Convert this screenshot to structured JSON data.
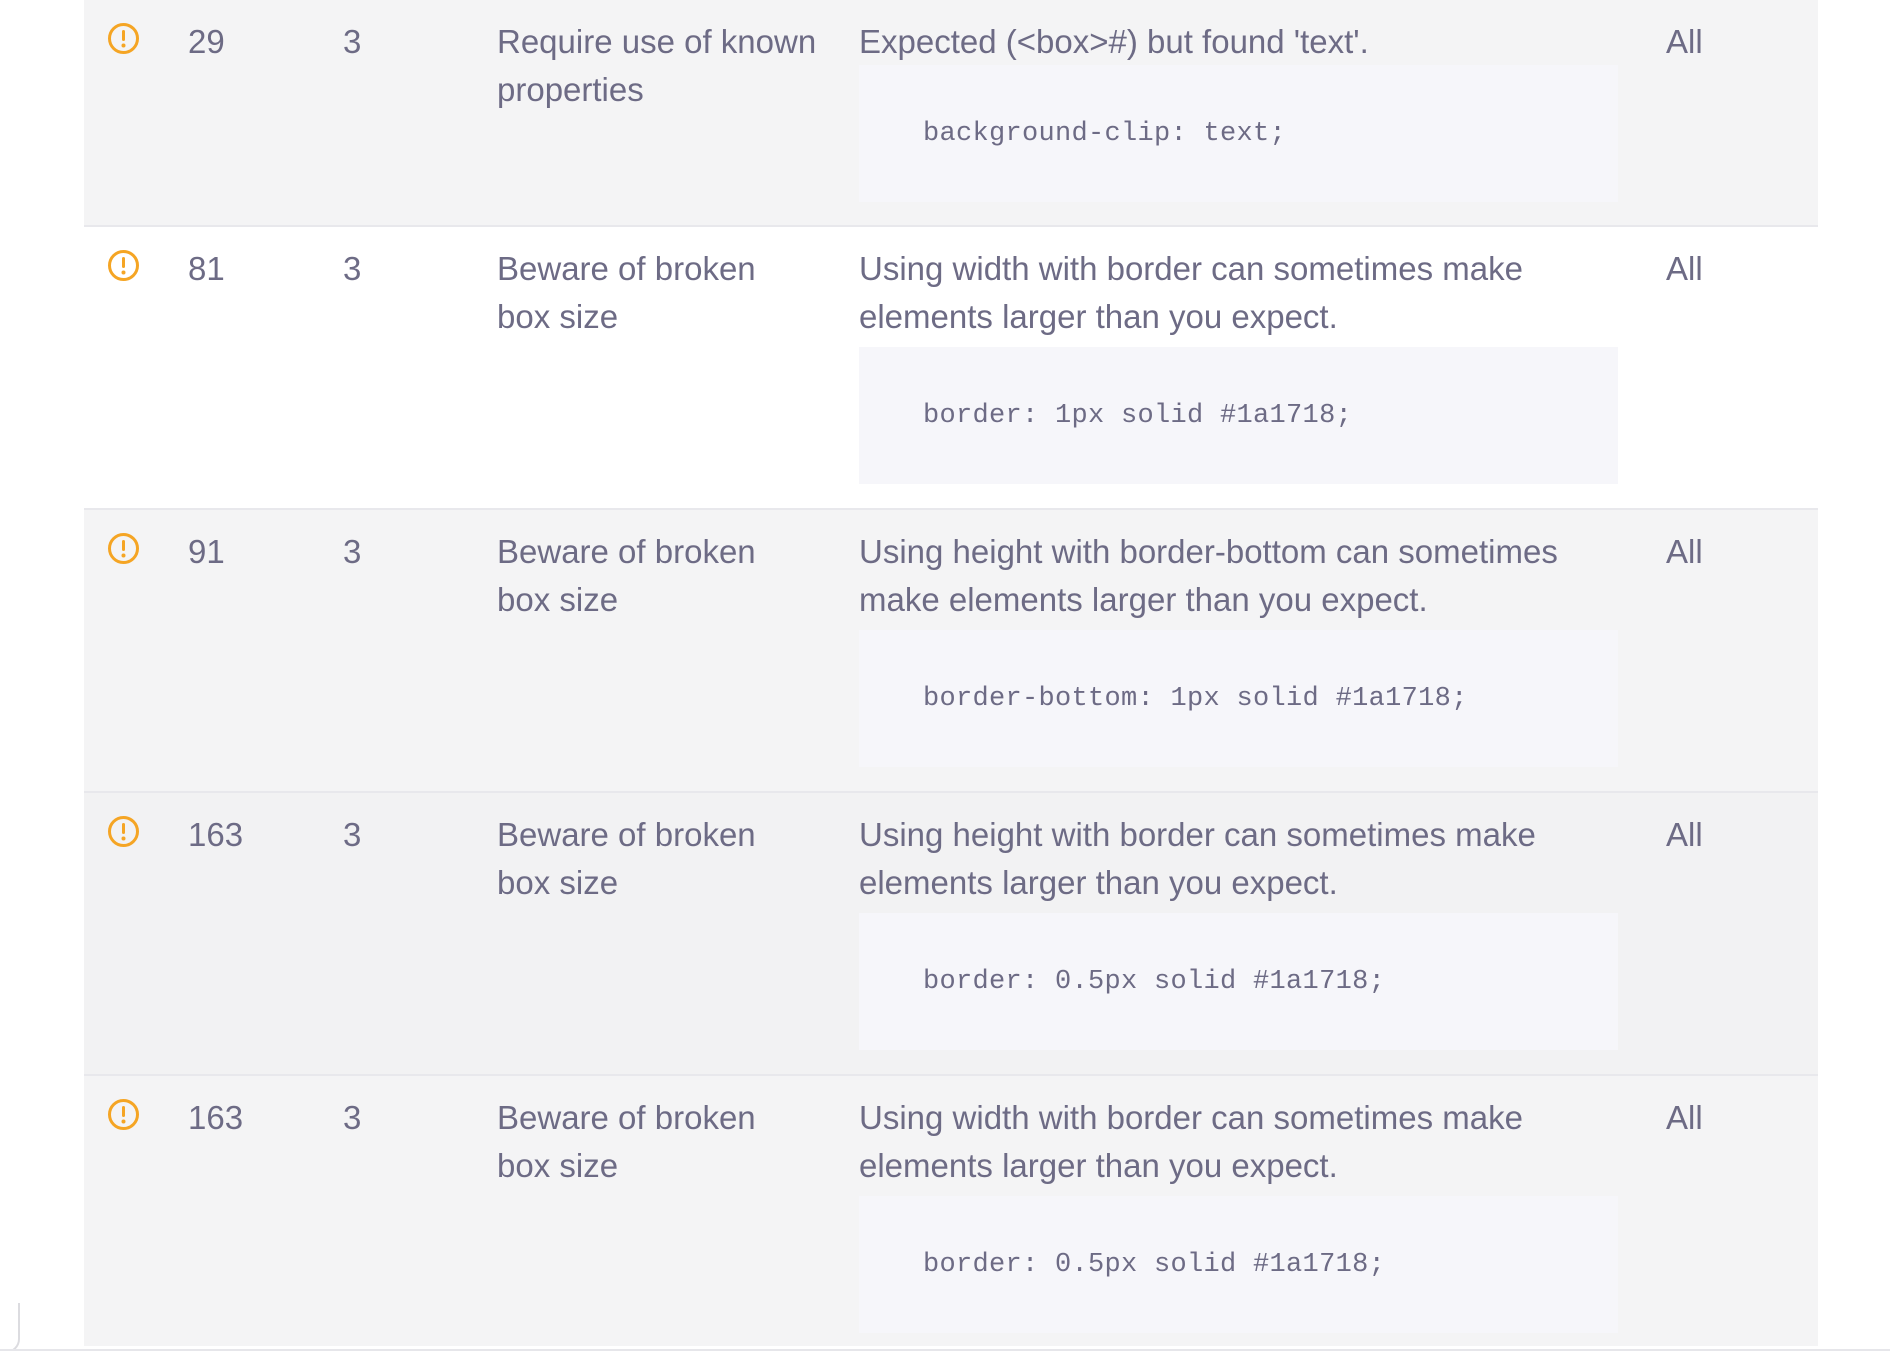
{
  "colors": {
    "warning_icon": "#f5a524",
    "text": "#6d6b85",
    "row_alt_background": "#f4f4f5",
    "code_background": "#f6f6fa"
  },
  "rows": [
    {
      "icon": "warning-icon",
      "line": "29",
      "column": "3",
      "rule": "Require use of known properties",
      "message": "Expected (<box>#) but found 'text'.",
      "code": "background-clip: text;",
      "browsers": "All"
    },
    {
      "icon": "warning-icon",
      "line": "81",
      "column": "3",
      "rule": "Beware of broken box size",
      "message": "Using width with border can sometimes make elements larger than you expect.",
      "code": "border: 1px solid #1a1718;",
      "browsers": "All"
    },
    {
      "icon": "warning-icon",
      "line": "91",
      "column": "3",
      "rule": "Beware of broken box size",
      "message": "Using height with border-bottom can sometimes make elements larger than you expect.",
      "code": "border-bottom: 1px solid #1a1718;",
      "browsers": "All"
    },
    {
      "icon": "warning-icon",
      "line": "163",
      "column": "3",
      "rule": "Beware of broken box size",
      "message": "Using height with border can sometimes make elements larger than you expect.",
      "code": "border: 0.5px solid #1a1718;",
      "browsers": "All"
    },
    {
      "icon": "warning-icon",
      "line": "163",
      "column": "3",
      "rule": "Beware of broken box size",
      "message": "Using width with border can sometimes make elements larger than you expect.",
      "code": "border: 0.5px solid #1a1718;",
      "browsers": "All"
    }
  ]
}
